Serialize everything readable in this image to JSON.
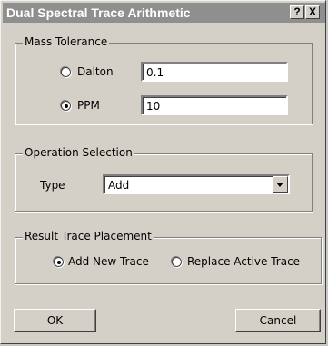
{
  "window": {
    "title": "Dual Spectral Trace Arithmetic",
    "help_label": "?",
    "close_label": "X"
  },
  "mass_tolerance": {
    "legend": "Mass Tolerance",
    "dalton_label": "Dalton",
    "dalton_value": "0.1",
    "ppm_label": "PPM",
    "ppm_value": "10",
    "selected": "PPM"
  },
  "operation": {
    "legend": "Operation Selection",
    "type_label": "Type",
    "type_value": "Add"
  },
  "placement": {
    "legend": "Result Trace Placement",
    "add_new_label": "Add New Trace",
    "replace_label": "Replace Active Trace",
    "selected": "Add New Trace"
  },
  "buttons": {
    "ok_label": "OK",
    "cancel_label": "Cancel"
  }
}
